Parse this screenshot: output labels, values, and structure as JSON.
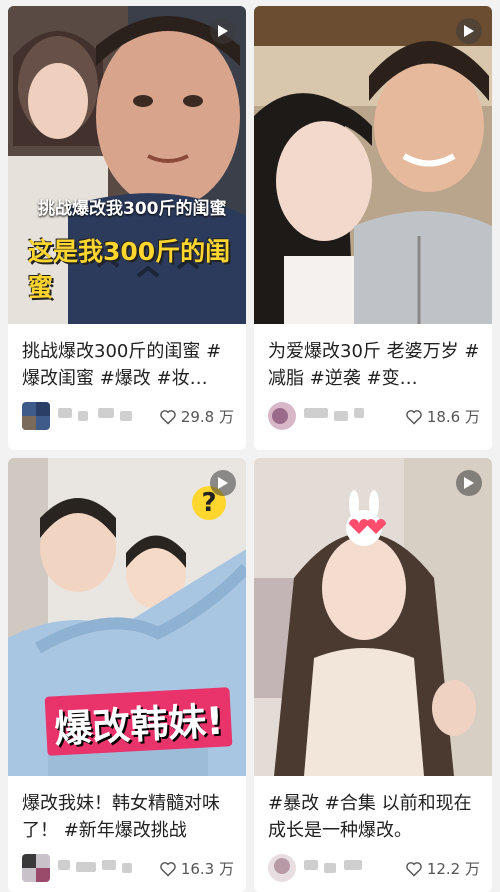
{
  "cards": [
    {
      "title": "挑战爆改300斤的闺蜜 #爆改闺蜜 #爆改 #妆…",
      "overlay_small": "挑战爆改我300斤的闺蜜",
      "overlay_big": "这是我300斤的闺蜜",
      "likes": "29.8 万"
    },
    {
      "title": "为爱爆改30斤 老婆万岁 #减脂 #逆袭 #变…",
      "likes": "18.6 万"
    },
    {
      "title": "爆改我妹！韩女精髓对味了！ #新年爆改挑战",
      "overlay_big": "爆改韩妹!",
      "overlay_mark": "?",
      "likes": "16.3 万"
    },
    {
      "title": "#暴改 #合集 以前和现在 成长是一种爆改。",
      "likes": "12.2 万"
    }
  ],
  "icons": {
    "play": "play-icon",
    "like": "heart-outline-icon"
  },
  "colors": {
    "background": "#f2f2f2",
    "card": "#ffffff",
    "title_text": "#222222",
    "meta_text": "#555555",
    "overlay_yellow": "#ffd62e",
    "overlay_pink": "#e8336b"
  }
}
